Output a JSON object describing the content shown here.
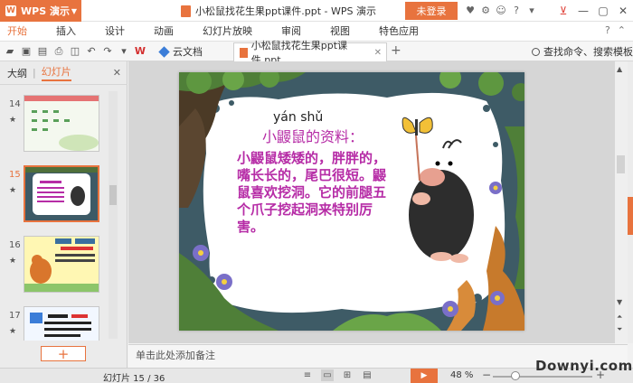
{
  "app": {
    "name": "WPS 演示",
    "logo_text": "W"
  },
  "title_bar": {
    "document_title": "小松鼠找花生果ppt课件.ppt - WPS 演示",
    "login_label": "未登录"
  },
  "menu": {
    "items": [
      "开始",
      "插入",
      "设计",
      "动画",
      "幻灯片放映",
      "审阅",
      "视图",
      "特色应用"
    ]
  },
  "toolbar": {
    "cloud_docs_label": "云文档",
    "active_tab_label": "小松鼠找花生果ppt课件.ppt",
    "search_label": "查找命令、搜索模板"
  },
  "left_panel": {
    "tab_outline": "大纲",
    "tab_slides": "幻灯片",
    "slide_numbers": [
      "14",
      "15",
      "16",
      "17"
    ],
    "selected_slide": "15",
    "add_slide_label": "+"
  },
  "slide": {
    "pinyin": "yán shǔ",
    "heading": "小鼹鼠的资料：",
    "body": "小鼹鼠矮矮的，胖胖的，嘴长长的，尾巴很短。鼹鼠喜欢挖洞。它的前腿五个爪子挖起洞来特别厉害。"
  },
  "notes": {
    "placeholder": "单击此处添加备注"
  },
  "status_bar": {
    "slide_indicator": "幻灯片 15 / 36",
    "zoom_label": "48 %",
    "zoom_level": 0.48
  },
  "watermark": {
    "text": "Downyi.com"
  },
  "colors": {
    "accent": "#e8733e",
    "slide_text": "#b62ca6"
  }
}
